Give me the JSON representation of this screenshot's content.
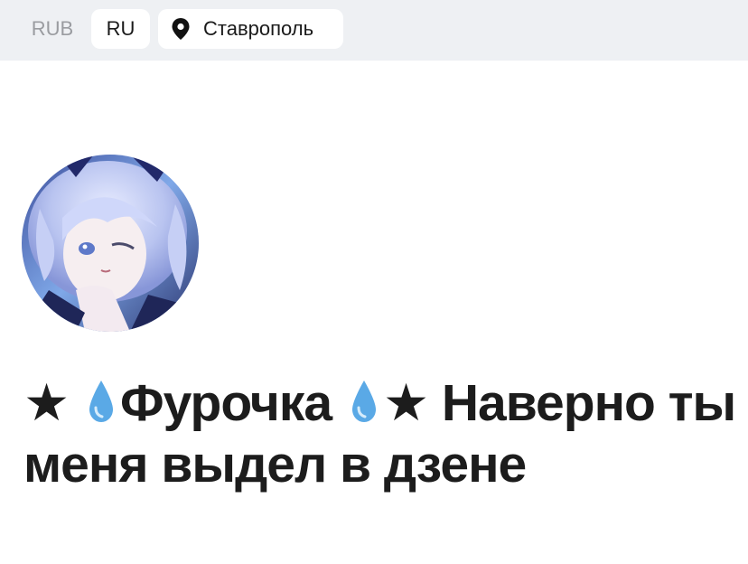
{
  "header": {
    "currency": "RUB",
    "language": "RU",
    "city": "Ставрополь",
    "city_icon": "location-pin-icon"
  },
  "profile": {
    "avatar_icon": "anime-avatar-image",
    "title_parts": {
      "star_left": "★",
      "name": "Фурочка",
      "star_right": "★",
      "subtitle": "Наверно ты меня выдел в дзене"
    },
    "drop_icon": "water-drop-emoji",
    "drop_color": "#5aa9e6"
  }
}
